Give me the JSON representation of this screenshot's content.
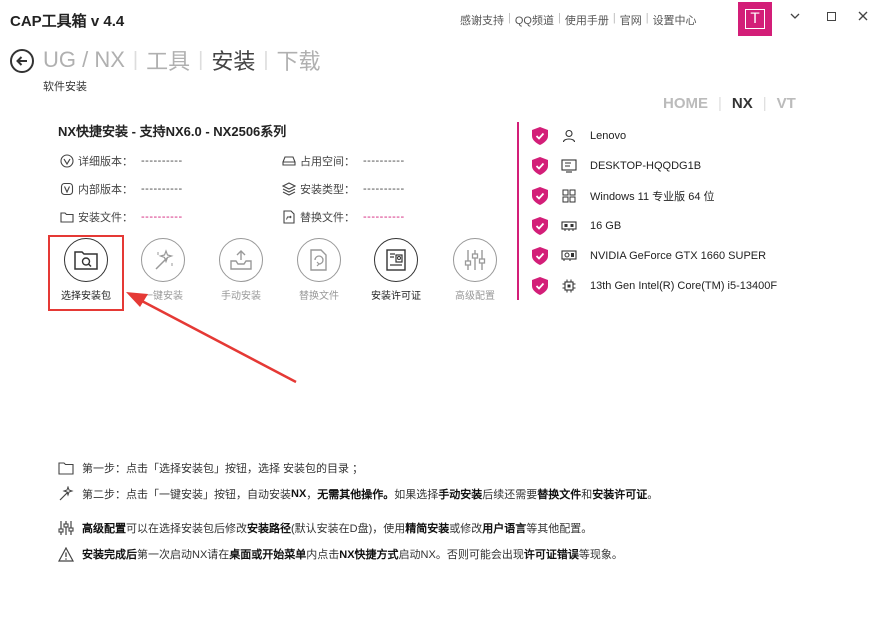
{
  "app": {
    "title": "CAP工具箱 v 4.4"
  },
  "toplinks": [
    "感谢支持",
    "QQ频道",
    "使用手册",
    "官网",
    "设置中心"
  ],
  "window": {
    "minimize": "⌄",
    "maximize": "□",
    "close": "✕",
    "logo_letter": "T",
    "accent": "#d31e78"
  },
  "breadcrumb": {
    "items": [
      "UG / NX",
      "工具",
      "安装",
      "下载"
    ],
    "current_index": 2
  },
  "subtitle": "软件安装",
  "version_tabs": {
    "items": [
      "HOME",
      "NX",
      "VT"
    ],
    "active": "NX"
  },
  "install": {
    "title": "NX快捷安装  -  支持NX6.0 - NX2506系列",
    "fields": {
      "detail_version": {
        "label": "详细版本：",
        "value": "----------"
      },
      "disk_space": {
        "label": "占用空间：",
        "value": "----------"
      },
      "internal_version": {
        "label": "内部版本：",
        "value": "----------"
      },
      "install_type": {
        "label": "安装类型：",
        "value": "----------"
      },
      "install_file": {
        "label": "安装文件：",
        "value": "----------"
      },
      "replace_file": {
        "label": "替换文件：",
        "value": "----------"
      }
    },
    "actions": [
      {
        "label": "选择安装包",
        "icon": "folder-search-icon",
        "enabled": true
      },
      {
        "label": "一键安装",
        "icon": "magic-wand-icon",
        "enabled": false
      },
      {
        "label": "手动安装",
        "icon": "install-box-icon",
        "enabled": false
      },
      {
        "label": "替换文件",
        "icon": "file-replace-icon",
        "enabled": false
      },
      {
        "label": "安装许可证",
        "icon": "license-icon",
        "enabled": true
      },
      {
        "label": "高级配置",
        "icon": "sliders-icon",
        "enabled": false
      }
    ]
  },
  "system": {
    "user": "Lenovo",
    "computer": "DESKTOP-HQQDG1B",
    "os": "Windows 11 专业版 64 位",
    "memory": "16 GB",
    "gpu": "NVIDIA GeForce GTX 1660 SUPER",
    "cpu": "13th Gen Intel(R) Core(TM) i5-13400F"
  },
  "steps": {
    "s1": {
      "a": "第一步：点击「选择安装包」按钮，选择 安装包的目录 ；"
    },
    "s2": {
      "a": "第二步：点击「一键安装」按钮，自动安装 ",
      "b": "NX",
      "c": " ，",
      "d": "无需其他操作。",
      "e": "如果选择 ",
      "f": "手动安装",
      "g": " 后续还需要 ",
      "h": "替换文件",
      "i": " 和 ",
      "j": "安装许可证",
      "k": " 。"
    },
    "s3": {
      "a": "高级配置",
      "b": " 可以在选择安装包后修改 ",
      "c": "安装路径",
      "d": " (默认安装在D盘)，使用 ",
      "e": "精简安装",
      "f": " 或修改 ",
      "g": "用户语言",
      "h": " 等其他配置。"
    },
    "s4": {
      "a": "安装完成后",
      "b": " 第一次启动NX请在 ",
      "c": "桌面或开始菜单",
      "d": " 内点击 ",
      "e": "NX快捷方式",
      "f": " 启动NX。否则可能会出现 ",
      "g": "许可证错误",
      "h": " 等现象。"
    }
  }
}
